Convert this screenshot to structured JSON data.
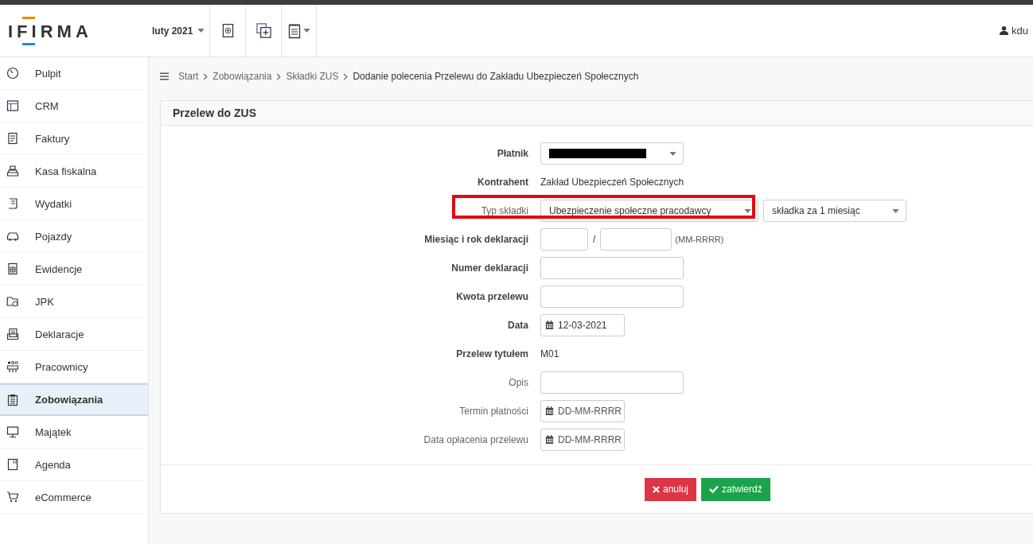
{
  "header": {
    "logo": "IFIRMA",
    "period": "luty 2021",
    "user": "kdu"
  },
  "sidebar": {
    "items": [
      {
        "label": "Pulpit",
        "selected": false
      },
      {
        "label": "CRM",
        "selected": false
      },
      {
        "label": "Faktury",
        "selected": false
      },
      {
        "label": "Kasa fiskalna",
        "selected": false
      },
      {
        "label": "Wydatki",
        "selected": false
      },
      {
        "label": "Pojazdy",
        "selected": false
      },
      {
        "label": "Ewidencje",
        "selected": false
      },
      {
        "label": "JPK",
        "selected": false
      },
      {
        "label": "Deklaracje",
        "selected": false
      },
      {
        "label": "Pracownicy",
        "selected": false
      },
      {
        "label": "Zobowiązania",
        "selected": true
      },
      {
        "label": "Majątek",
        "selected": false
      },
      {
        "label": "Agenda",
        "selected": false
      },
      {
        "label": "eCommerce",
        "selected": false
      }
    ]
  },
  "breadcrumb": [
    "Start",
    "Zobowiązania",
    "Składki ZUS",
    "Dodanie polecenia Przelewu do Zakładu Ubezpieczeń Społecznych"
  ],
  "panel": {
    "title": "Przelew do ZUS",
    "rows": [
      {
        "kind": "select-redacted",
        "label": "Płatnik",
        "required": true
      },
      {
        "kind": "text",
        "label": "Kontrahent",
        "required": true,
        "value": "Zakład Ubezpieczeń Społecznych"
      },
      {
        "kind": "double-select",
        "label": "Typ składki",
        "required": false,
        "highlighted": true,
        "value": "Ubezpieczenie społeczne pracodawcy",
        "value2": "składka za 1 miesiąc"
      },
      {
        "kind": "month-year",
        "label": "Miesiąc i rok deklaracji",
        "required": true,
        "separator": "/",
        "hint": "(MM-RRRR)"
      },
      {
        "kind": "input",
        "label": "Numer deklaracji",
        "required": true
      },
      {
        "kind": "input",
        "label": "Kwota przelewu",
        "required": true
      },
      {
        "kind": "date",
        "label": "Data",
        "required": true,
        "value": "12-03-2021"
      },
      {
        "kind": "text",
        "label": "Przelew tytułem",
        "required": true,
        "value": "M01"
      },
      {
        "kind": "input",
        "label": "Opis",
        "required": false
      },
      {
        "kind": "date",
        "label": "Termin płatności",
        "required": false,
        "placeholder": "DD-MM-RRRR"
      },
      {
        "kind": "date",
        "label": "Data opłacenia przelewu",
        "required": false,
        "placeholder": "DD-MM-RRRR"
      }
    ],
    "buttons": [
      {
        "kind": "cancel",
        "label": "anuluj"
      },
      {
        "kind": "confirm",
        "label": "zatwierdź"
      }
    ]
  }
}
